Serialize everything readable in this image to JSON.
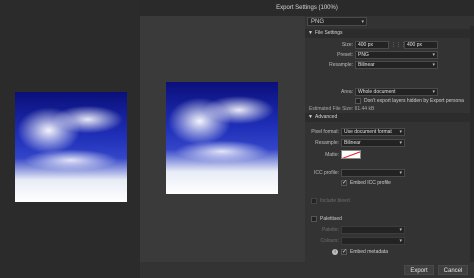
{
  "window": {
    "title": "Export Settings (100%)"
  },
  "format": {
    "value": "PNG"
  },
  "file_settings": {
    "header": "File Settings",
    "size_label": "Size:",
    "width": "400 px",
    "link_label": "⋮⋮⋮",
    "height": "400 px",
    "preset_label": "Preset:",
    "preset": "PNG",
    "resample_label": "Resample:",
    "resample": "Bilinear",
    "area_label": "Area:",
    "area": "Whole document",
    "dont_export_hidden": "Don't export layers hidden by Export persona",
    "estimated_size": "Estimated File Size: 61.44 kB"
  },
  "advanced": {
    "header": "Advanced",
    "pixel_format_label": "Pixel format:",
    "pixel_format": "Use document format",
    "resample_label": "Resample:",
    "resample": "Bilinear",
    "matte_label": "Matte:",
    "icc_label": "ICC profile:",
    "icc": "",
    "embed_icc": "Embed ICC profile",
    "include_bleed": "Include bleed",
    "palettised": "Palettised",
    "palette_label": "Palette:",
    "colours_label": "Colours:",
    "embed_metadata": "Embed metadata"
  },
  "buttons": {
    "export": "Export",
    "cancel": "Cancel"
  },
  "colors": {
    "dialog_bg": "#3a3a3a",
    "panel_bg": "#333333",
    "section_bg": "#2c2c2c"
  }
}
